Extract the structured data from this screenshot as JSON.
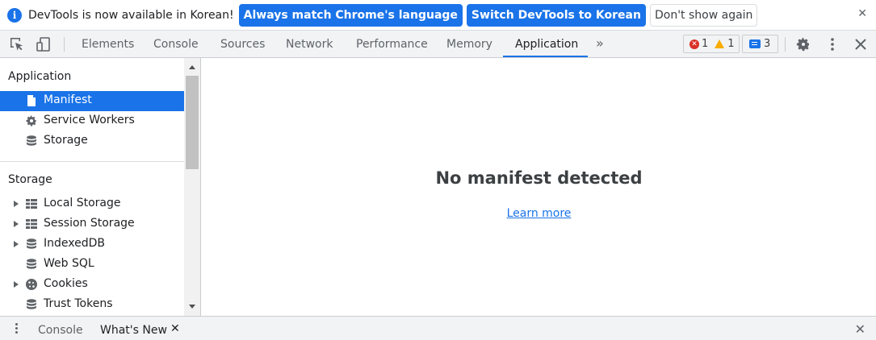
{
  "infobar": {
    "message": "DevTools is now available in Korean!",
    "btn_match": "Always match Chrome's language",
    "btn_switch": "Switch DevTools to Korean",
    "btn_dismiss": "Don't show again",
    "close": "✕"
  },
  "toolbar": {
    "tabs": [
      "Elements",
      "Console",
      "Sources",
      "Network",
      "Performance",
      "Memory",
      "Application"
    ],
    "more": "»",
    "errors": "1",
    "warnings": "1",
    "messages": "3"
  },
  "sidebar": {
    "application_header": "Application",
    "application_items": [
      "Manifest",
      "Service Workers",
      "Storage"
    ],
    "storage_header": "Storage",
    "storage_items": [
      "Local Storage",
      "Session Storage",
      "IndexedDB",
      "Web SQL",
      "Cookies",
      "Trust Tokens"
    ]
  },
  "main": {
    "title": "No manifest detected",
    "link": "Learn more"
  },
  "drawer": {
    "tabs": [
      "Console",
      "What's New"
    ],
    "tab_close": "✕",
    "close": "✕"
  },
  "colors": {
    "accent": "#1a73e8",
    "error": "#d93025",
    "warning": "#f9ab00"
  }
}
